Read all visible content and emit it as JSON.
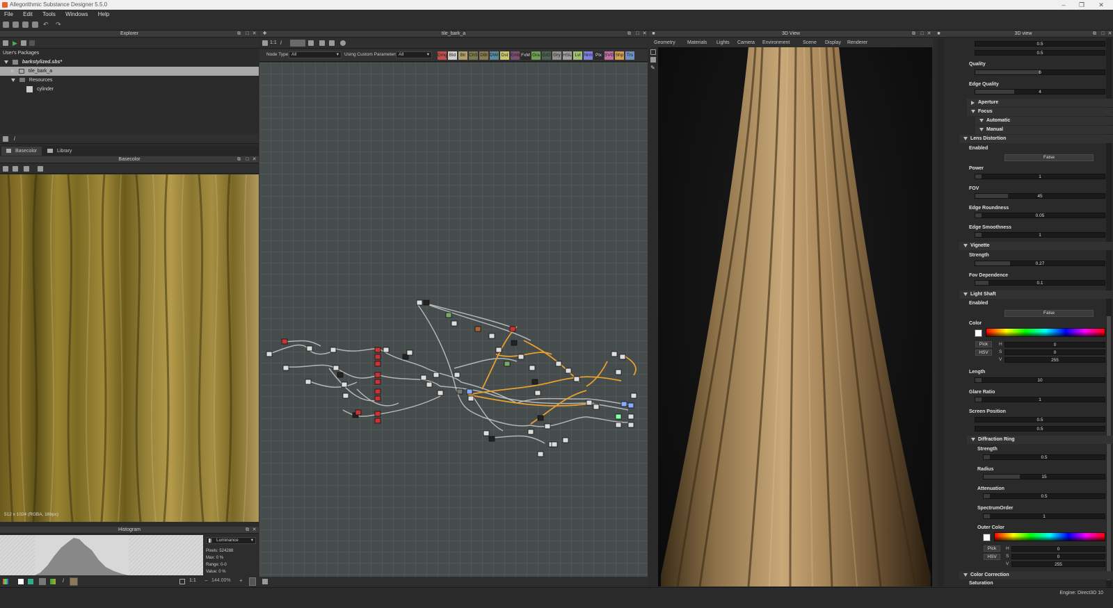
{
  "app": {
    "title": "Allegorithmic Substance Designer 5.5.0"
  },
  "menu": [
    "File",
    "Edit",
    "Tools",
    "Windows",
    "Help"
  ],
  "explorer": {
    "title": "Explorer",
    "section_label": "User's Packages",
    "package": "barkstylized.sbs*",
    "graph": "tile_bark_a",
    "folder": "Resources",
    "resource": "cylinder",
    "info_icon": "i"
  },
  "tabs": {
    "basecolor": "Basecolor",
    "library": "Library"
  },
  "preview2d": {
    "title": "Basecolor",
    "status": "512 x 1024 (RGBA, 16bpc)"
  },
  "histogram": {
    "title": "Histogram",
    "channel": "Luminance",
    "stats": [
      {
        "label": "Pixels:",
        "value": "524288"
      },
      {
        "label": "Max:",
        "value": "0 %"
      },
      {
        "label": "Range:",
        "value": "0-0"
      },
      {
        "label": "Value:",
        "value": "0 %"
      }
    ],
    "zoom_ratio": "1:1",
    "zoom_pct": "144.00%"
  },
  "graph": {
    "title": "tile_bark_a",
    "zoom_label": "1:1",
    "node_type_label": "Node Type",
    "node_type_value": "All",
    "custom_params_label": "Using Custom Parameters",
    "custom_params_value": "All",
    "node_filters": [
      {
        "label": "Dmg",
        "color": "#c05050"
      },
      {
        "label": "Bld",
        "color": "#d0d0d0"
      },
      {
        "label": "Blr",
        "color": "#b0a070"
      },
      {
        "label": "ChS",
        "color": "#7a7a50"
      },
      {
        "label": "DBl",
        "color": "#8a7a50"
      },
      {
        "label": "DWr",
        "color": "#5a8aa0"
      },
      {
        "label": "Dst",
        "color": "#c8c870"
      },
      {
        "label": "Emb",
        "color": "#7a5070"
      },
      {
        "label": "FxM",
        "color": "#2a2a2a"
      },
      {
        "label": "Gra",
        "color": "#70a050"
      },
      {
        "label": "GrD",
        "color": "#506050"
      },
      {
        "label": "Gry",
        "color": "#909090"
      },
      {
        "label": "HSL",
        "color": "#a0a0a0"
      },
      {
        "label": "Lvl",
        "color": "#a0c070"
      },
      {
        "label": "Nrm",
        "color": "#8080e0"
      },
      {
        "label": "Pix",
        "color": "#2a2a2a"
      },
      {
        "label": "SVG",
        "color": "#c070a0"
      },
      {
        "label": "Shp",
        "color": "#d0a050"
      },
      {
        "label": "Trs",
        "color": "#7090c0"
      }
    ]
  },
  "view3d": {
    "title": "3D View",
    "menu": [
      "Geometry",
      "Materials",
      "Lights",
      "Camera",
      "Environment",
      "Scene",
      "Display",
      "Renderer"
    ]
  },
  "props": {
    "title": "3D view",
    "top_values": [
      "0.5",
      "0.5"
    ],
    "quality": {
      "label": "Quality",
      "value": "6",
      "fill": 0.5
    },
    "edge_quality": {
      "label": "Edge Quality",
      "value": "4",
      "fill": 0.3
    },
    "aperture": "Aperture",
    "focus": "Focus",
    "automatic": "Automatic",
    "manual": "Manual",
    "lens_distortion": "Lens Distortion",
    "enabled_label": "Enabled",
    "enabled_value": "False",
    "power": {
      "label": "Power",
      "value": "1",
      "fill": 0.05
    },
    "fov": {
      "label": "FOV",
      "value": "45",
      "fill": 0.25
    },
    "edge_roundness": {
      "label": "Edge Roundness",
      "value": "0.05",
      "fill": 0.05
    },
    "edge_smoothness": {
      "label": "Edge Smoothness",
      "value": "1",
      "fill": 0.05
    },
    "vignette": "Vignette",
    "strength": {
      "label": "Strength",
      "value": "0.27",
      "fill": 0.27
    },
    "fov_dependence": {
      "label": "Fov Dependence",
      "value": "0.1",
      "fill": 0.1
    },
    "light_shaft": "Light Shaft",
    "ls_enabled_label": "Enabled",
    "ls_enabled_value": "False",
    "color_label": "Color",
    "pick": "Pick",
    "hsv": "HSV",
    "h": {
      "label": "H",
      "value": "0"
    },
    "s": {
      "label": "S",
      "value": "0"
    },
    "v": {
      "label": "V",
      "value": "255"
    },
    "length": {
      "label": "Length",
      "value": "10",
      "fill": 0.05
    },
    "glare_ratio": {
      "label": "Glare Ratio",
      "value": "1",
      "fill": 0.05
    },
    "screen_position": {
      "label": "Screen Position",
      "values": [
        "0.5",
        "0.5"
      ]
    },
    "diffraction_ring": "Diffraction Ring",
    "dr_strength": {
      "label": "Strength",
      "value": "0.5",
      "fill": 0.05
    },
    "radius": {
      "label": "Radius",
      "value": "15",
      "fill": 0.3
    },
    "attenuation": {
      "label": "Attenuation",
      "value": "0.5",
      "fill": 0.05
    },
    "spectrum_order": {
      "label": "SpectrumOrder",
      "value": "1",
      "fill": 0.05
    },
    "outer_color": "Outer Color",
    "oc_pick": "Pick",
    "oc_hsv": "HSV",
    "oc_h": {
      "label": "H",
      "value": "0"
    },
    "oc_s": {
      "label": "S",
      "value": "0"
    },
    "oc_v": {
      "label": "V",
      "value": "255"
    },
    "color_correction": "Color Correction",
    "saturation": "Saturation"
  },
  "statusbar": {
    "engine": "Engine: Direct3D 10"
  }
}
